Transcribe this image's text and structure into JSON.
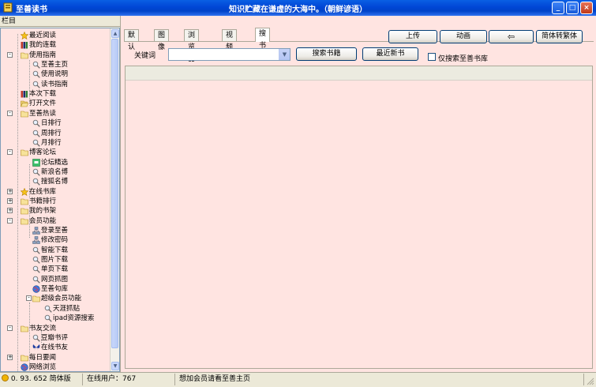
{
  "window": {
    "app_title": "至善读书",
    "slogan": "知识贮藏在谦虚的大海中。（朝鲜谚语）",
    "minimize_label": "_",
    "maximize_label": "□",
    "close_label": "×"
  },
  "sidebar": {
    "header": "栏目",
    "items": [
      {
        "label": "最近阅读",
        "icon": "star-icon"
      },
      {
        "label": "我的连载",
        "icon": "books-icon"
      },
      {
        "label": "使用指南",
        "icon": "folder-icon"
      },
      {
        "label": "至善主页",
        "icon": "magnifier-icon"
      },
      {
        "label": "使用说明",
        "icon": "magnifier-icon"
      },
      {
        "label": "读书指南",
        "icon": "magnifier-icon"
      },
      {
        "label": "本次下载",
        "icon": "books-icon"
      },
      {
        "label": "打开文件",
        "icon": "open-folder-icon"
      },
      {
        "label": "至善热读",
        "icon": "folder-icon"
      },
      {
        "label": "日排行",
        "icon": "magnifier-icon"
      },
      {
        "label": "周排行",
        "icon": "magnifier-icon"
      },
      {
        "label": "月排行",
        "icon": "magnifier-icon"
      },
      {
        "label": "博客论坛",
        "icon": "folder-icon"
      },
      {
        "label": "论坛精选",
        "icon": "forum-icon"
      },
      {
        "label": "新浪名博",
        "icon": "magnifier-icon"
      },
      {
        "label": "搜狐名博",
        "icon": "magnifier-icon"
      },
      {
        "label": "在线书库",
        "icon": "star-icon"
      },
      {
        "label": "书籍排行",
        "icon": "folder-icon"
      },
      {
        "label": "我的书架",
        "icon": "folder-icon"
      },
      {
        "label": "会员功能",
        "icon": "folder-icon"
      },
      {
        "label": "登录至善",
        "icon": "network-icon"
      },
      {
        "label": "修改密码",
        "icon": "network-icon"
      },
      {
        "label": "智能下载",
        "icon": "magnifier-icon"
      },
      {
        "label": "图片下载",
        "icon": "magnifier-icon"
      },
      {
        "label": "单页下载",
        "icon": "magnifier-icon"
      },
      {
        "label": "网页抓图",
        "icon": "magnifier-icon"
      },
      {
        "label": "至善句库",
        "icon": "globe-icon"
      },
      {
        "label": "超级会员功能",
        "icon": "folder-icon"
      },
      {
        "label": "天涯抓贴",
        "icon": "magnifier-icon"
      },
      {
        "label": "ipad资源搜索",
        "icon": "magnifier-icon"
      },
      {
        "label": "书友交流",
        "icon": "folder-icon"
      },
      {
        "label": "豆瓣书评",
        "icon": "magnifier-icon"
      },
      {
        "label": "在线书友",
        "icon": "butterfly-icon"
      },
      {
        "label": "每日要闻",
        "icon": "folder-icon"
      },
      {
        "label": "网络浏览",
        "icon": "globe-icon"
      }
    ]
  },
  "tabs": [
    "默认",
    "图像",
    "浏览器",
    "视频",
    "搜书"
  ],
  "active_tab": "搜书",
  "toolbar": {
    "upload": "上传",
    "animation": "动画",
    "back_arrow": "⇦",
    "convert": "简体转繁体"
  },
  "search": {
    "keyword_label": "关键词",
    "keyword_value": "",
    "search_button": "搜索书籍",
    "latest_button": "最近新书",
    "only_local_label": "仅搜索至善书库",
    "only_local_checked": false
  },
  "status": {
    "version": "0. 93. 652",
    "edition": "简体版",
    "online_users": "在线用户：767",
    "member_hint": "想加会员请看至善主页"
  },
  "colors": {
    "accent_bg": "#ffe4e1",
    "titlebar": "#0046d5"
  }
}
